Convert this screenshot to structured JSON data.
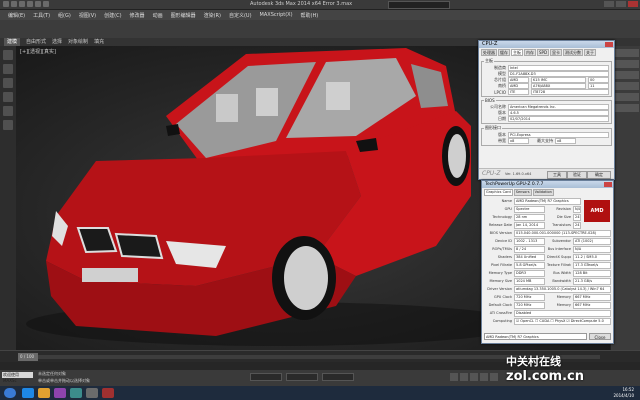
{
  "window": {
    "title": "Autodesk 3ds Max 2014 x64    Error 3.max",
    "search_placeholder": ""
  },
  "menubar": {
    "items": [
      "编辑(E)",
      "工具(T)",
      "组(G)",
      "视图(V)",
      "创建(C)",
      "修改器",
      "动画",
      "图形编辑器",
      "渲染(R)",
      "自定义(U)",
      "MAXScript(X)",
      "帮助(H)"
    ]
  },
  "ribbon_tabs": {
    "items": [
      "建模",
      "自由形式",
      "选择",
      "对象绘制",
      "填充"
    ],
    "active_index": 0
  },
  "viewport": {
    "label": "[+][透视][真实]",
    "subject": "red sedan 3D model"
  },
  "cpuz": {
    "title": "CPU-Z",
    "tabs": [
      "处理器",
      "缓存",
      "主板",
      "内存",
      "SPD",
      "显卡",
      "测试分数",
      "关于"
    ],
    "active_tab": "主板",
    "mainboard_legend": "主板",
    "manufacturer_label": "制造商",
    "manufacturer": "Intel",
    "model_label": "模型",
    "model": "D1-F2A88X-D3",
    "chipset_label": "芯片组",
    "chipset": "AMD",
    "chipset_model": "K15 IMC",
    "chipset_rev_label": "修订",
    "chipset_rev": "00",
    "southbridge_label": "南桥",
    "southbridge": "AMD",
    "southbridge_model": "A76/A88X",
    "southbridge_rev": "11",
    "lpcio_label": "LPCIO",
    "lpcio": "ITE",
    "lpcio_model": "IT8728",
    "bios_legend": "BIOS",
    "brand_label": "公司名称",
    "brand": "American Megatrends Inc.",
    "version_label": "版本",
    "version": "4.6.5",
    "date_label": "日期",
    "date": "02/07/2014",
    "graphic_legend": "图形接口",
    "gi_version_label": "版本",
    "gi_version": "PCI-Express",
    "link_width_label": "带宽",
    "link_width": "x8",
    "max_supported_label": "最大支持",
    "max_supported": "x8",
    "footer_logo": "CPU-Z",
    "footer_version": "Ver. 1.69.0.x64",
    "tools_button": "工具",
    "validate_button": "验证",
    "ok_button": "确定"
  },
  "gpuz": {
    "title": "TechPowerUp GPU-Z 0.7.7",
    "tabs": [
      "Graphics Card",
      "Sensors",
      "Validation"
    ],
    "active_tab": "Graphics Card",
    "vendor_logo": "AMD",
    "rows": [
      {
        "label": "Name",
        "value": "AMD Radeon(TM) R7 Graphics"
      },
      {
        "label": "GPU",
        "value": "Spectre",
        "sub_label": "Revision",
        "sub_value": "N/A"
      },
      {
        "label": "Technology",
        "value": "28 nm",
        "sub_label": "Die Size",
        "sub_value": "245 mm²"
      },
      {
        "label": "Release Date",
        "value": "Jan 14, 2014",
        "sub_label": "Transistors",
        "sub_value": "2410M"
      },
      {
        "label": "BIOS Version",
        "value": "015.040.000.001.000000 (113-SPECTRE-028)"
      },
      {
        "label": "Device ID",
        "value": "1002 - 1313",
        "sub_label": "Subvendor",
        "sub_value": "ATI (1002)"
      },
      {
        "label": "ROPs/TMUs",
        "value": "8 / 24",
        "sub_label": "Bus Interface",
        "sub_value": "N/A"
      },
      {
        "label": "Shaders",
        "value": "384 Unified",
        "sub_label": "DirectX Support",
        "sub_value": "11.2 / SM5.0"
      },
      {
        "label": "Pixel Fillrate",
        "value": "5.8 GPixel/s",
        "sub_label": "Texture Fillrate",
        "sub_value": "17.3 GTexel/s"
      },
      {
        "label": "Memory Type",
        "value": "DDR3",
        "sub_label": "Bus Width",
        "sub_value": "128 Bit"
      },
      {
        "label": "Memory Size",
        "value": "1024 MB",
        "sub_label": "Bandwidth",
        "sub_value": "21.3 GB/s"
      },
      {
        "label": "Driver Version",
        "value": "atiumdag 13.350.1005.0 (Catalyst 14.3) / Win7 64"
      },
      {
        "label": "GPU Clock",
        "value": "720 MHz",
        "sub_label": "Memory",
        "sub_value": "667 MHz"
      },
      {
        "label": "Default Clock",
        "value": "720 MHz",
        "sub_label": "Memory",
        "sub_value": "667 MHz"
      },
      {
        "label": "ATI CrossFire",
        "value": "Disabled"
      },
      {
        "label": "Computing",
        "value": "☑ OpenCL  ☐ CUDA  ☐ PhysX  ☑ DirectCompute 5.0"
      }
    ],
    "device_select": "AMD Radeon(TM) R7 Graphics",
    "close_button": "Close"
  },
  "timeline": {
    "frame_counter": "0 / 100"
  },
  "status": {
    "maxscript_label": "欢迎使用 MAXSc",
    "line1": "未选定任何对象",
    "line2": "单击或单击并拖动以选择对象"
  },
  "taskbar": {
    "time": "16:52",
    "date": "2014/4/10"
  },
  "watermark": {
    "cn": "中关村在线",
    "en": "zol.com.cn"
  },
  "colors": {
    "car_body": "#c8141a",
    "viewport_bg": "#262626",
    "amd_red": "#b01010"
  }
}
